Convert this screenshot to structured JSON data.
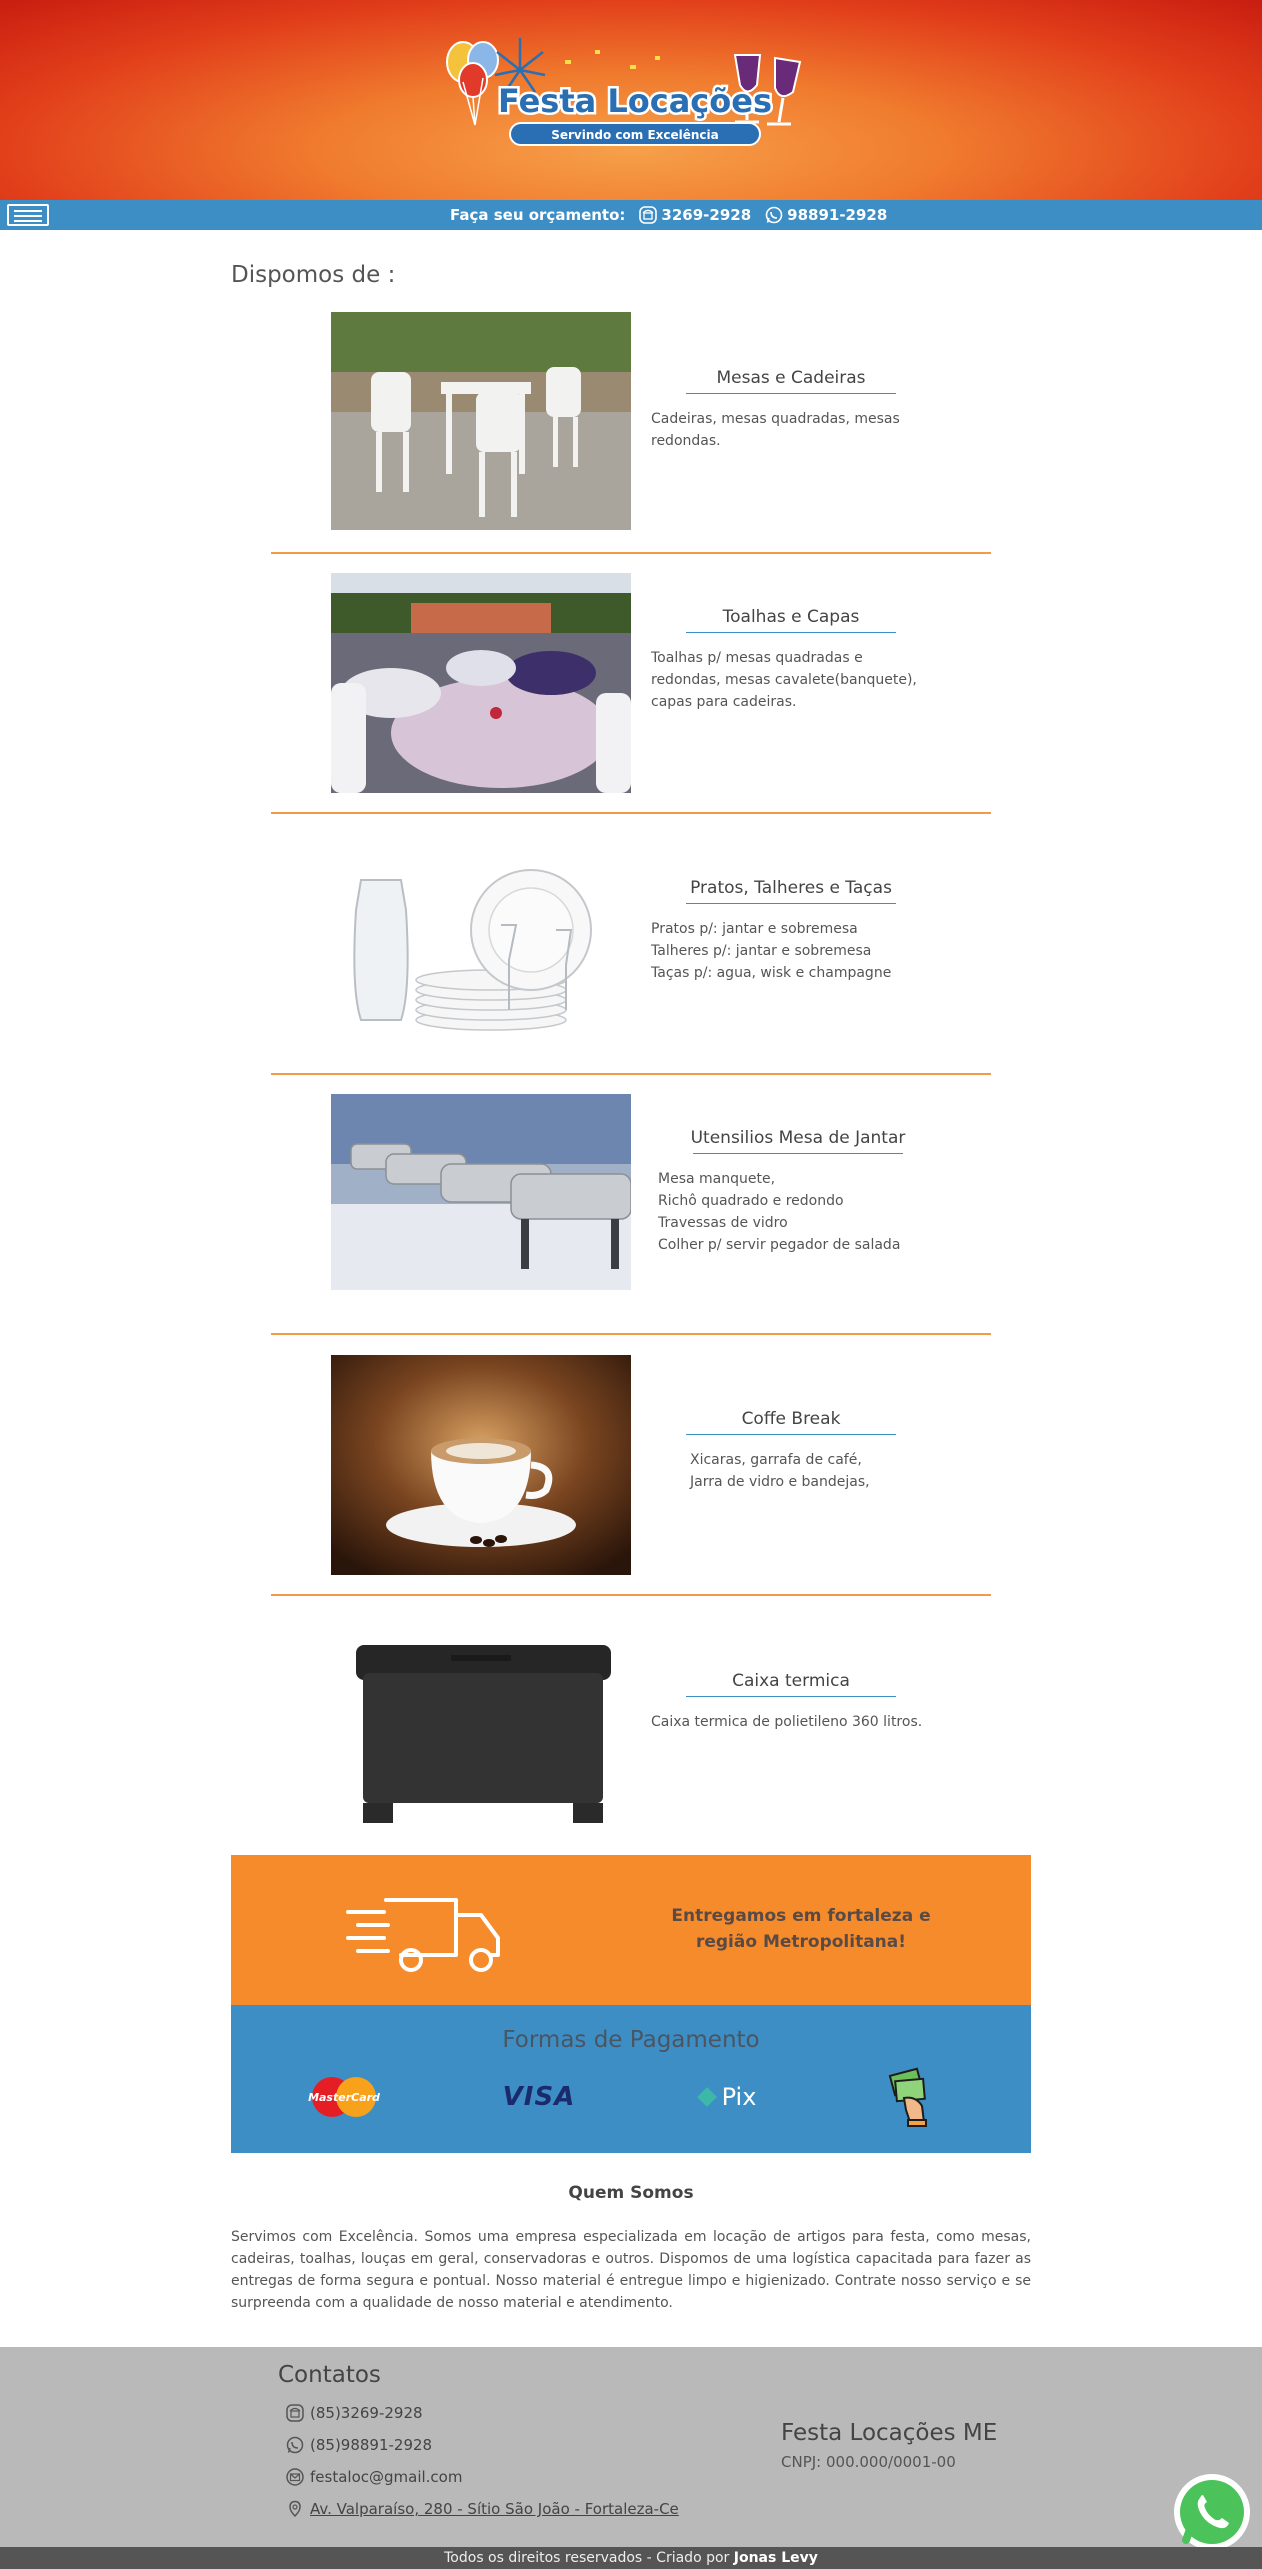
{
  "header": {
    "logo_title": "Festa Locações",
    "logo_tagline": "Servindo com Excelência"
  },
  "topbar": {
    "quote_label": "Faça seu orçamento:",
    "phone1": "3269-2928",
    "phone2": "98891-2928"
  },
  "section_title": "Dispomos de :",
  "products": [
    {
      "title": "Mesas e Cadeiras",
      "desc": "Cadeiras, mesas quadradas, mesas redondas."
    },
    {
      "title": "Toalhas e Capas",
      "desc": "Toalhas p/ mesas quadradas e redondas, mesas cavalete(banquete), capas para cadeiras."
    },
    {
      "title": "Pratos, Talheres e Taças",
      "desc": "Pratos p/: jantar e sobremesa\nTalheres p/: jantar e sobremesa\nTaças p/: agua, wisk e champagne"
    },
    {
      "title": "Utensilios Mesa de Jantar",
      "desc": "Mesa manquete,\nRichô quadrado e redondo\nTravessas de vidro\nColher p/ servir pegador de salada"
    },
    {
      "title": "Coffe Break",
      "desc": "Xicaras, garrafa de café,\nJarra de vidro e bandejas,"
    },
    {
      "title": "Caixa termica",
      "desc": "Caixa termica de polietileno 360 litros."
    }
  ],
  "delivery": {
    "text": "Entregamos em fortaleza e região Metropolitana!"
  },
  "payment": {
    "title": "Formas de Pagamento",
    "mastercard": "MasterCard",
    "visa": "VISA",
    "pix": "Pix"
  },
  "about": {
    "title": "Quem Somos",
    "text": "Servimos com Excelência. Somos uma empresa especializada em locação de artigos para festa, como mesas, cadeiras, toalhas, louças em geral, conservadoras e outros. Dispomos de uma logística capacitada para fazer as entregas de forma segura e pontual. Nosso material é entregue limpo e higienizado. Contrate nosso serviço e se surpreenda com a qualidade de nosso material e atendimento."
  },
  "footer": {
    "contacts_title": "Contatos",
    "phone1": "(85)3269-2928",
    "phone2": "(85)98891-2928",
    "email": "festaloc@gmail.com",
    "address": "Av. Valparaíso, 280 - Sítio São João - Fortaleza-Ce",
    "company": "Festa Locações ME",
    "cnpj": "CNPJ: 000.000/0001-00"
  },
  "bottom": {
    "rights": "Todos os direitos reservados - Criado por ",
    "author": "Jonas Levy"
  },
  "colors": {
    "orange": "#f68b2c",
    "blue": "#3e8ec6",
    "footer_gray": "#b9b9b9",
    "header_red": "#c81d10"
  }
}
